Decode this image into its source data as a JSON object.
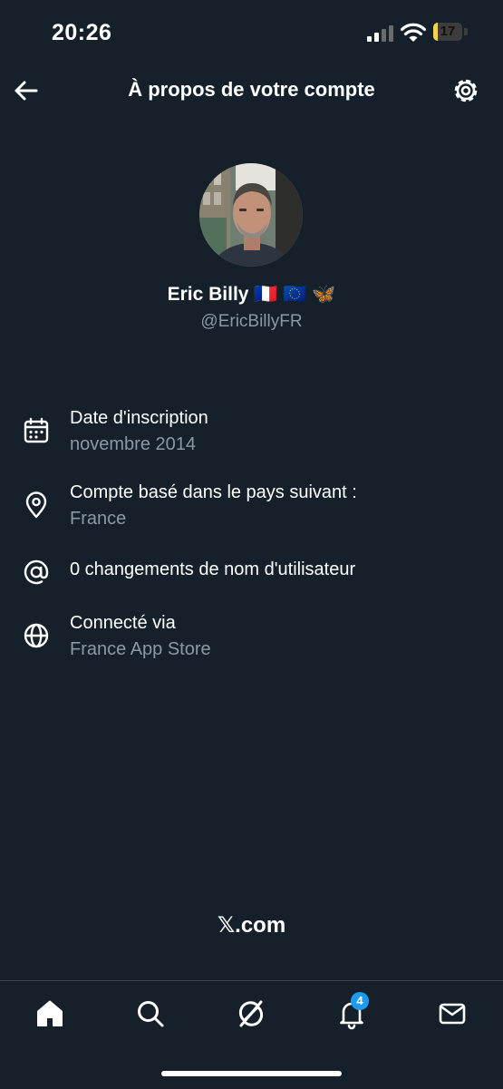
{
  "status_bar": {
    "time": "20:26",
    "battery_level": "17",
    "battery_percent": 17
  },
  "header": {
    "title": "À propos de votre compte",
    "back_icon": "arrow-left-icon",
    "settings_icon": "gear-icon"
  },
  "profile": {
    "name": "Eric Billy 🇫🇷 🇪🇺 🦋",
    "handle": "@EricBillyFR"
  },
  "info": [
    {
      "icon": "calendar-icon",
      "label": "Date d'inscription",
      "value": "novembre 2014"
    },
    {
      "icon": "location-pin-icon",
      "label": "Compte basé dans le pays suivant :",
      "value": "France"
    },
    {
      "icon": "at-sign-icon",
      "label": "0 changements de nom d'utilisateur",
      "value": ""
    },
    {
      "icon": "globe-icon",
      "label": "Connecté via",
      "value": "France App Store"
    }
  ],
  "footer": {
    "brand": "𝕏.com"
  },
  "tabbar": {
    "items": [
      "home-icon",
      "search-icon",
      "grok-icon",
      "bell-icon",
      "mail-icon"
    ],
    "notifications_count": "4"
  },
  "colors": {
    "background": "#15202b",
    "secondary_text": "#8b98a5",
    "accent": "#1d9bf0",
    "battery": "#f3d34a"
  }
}
